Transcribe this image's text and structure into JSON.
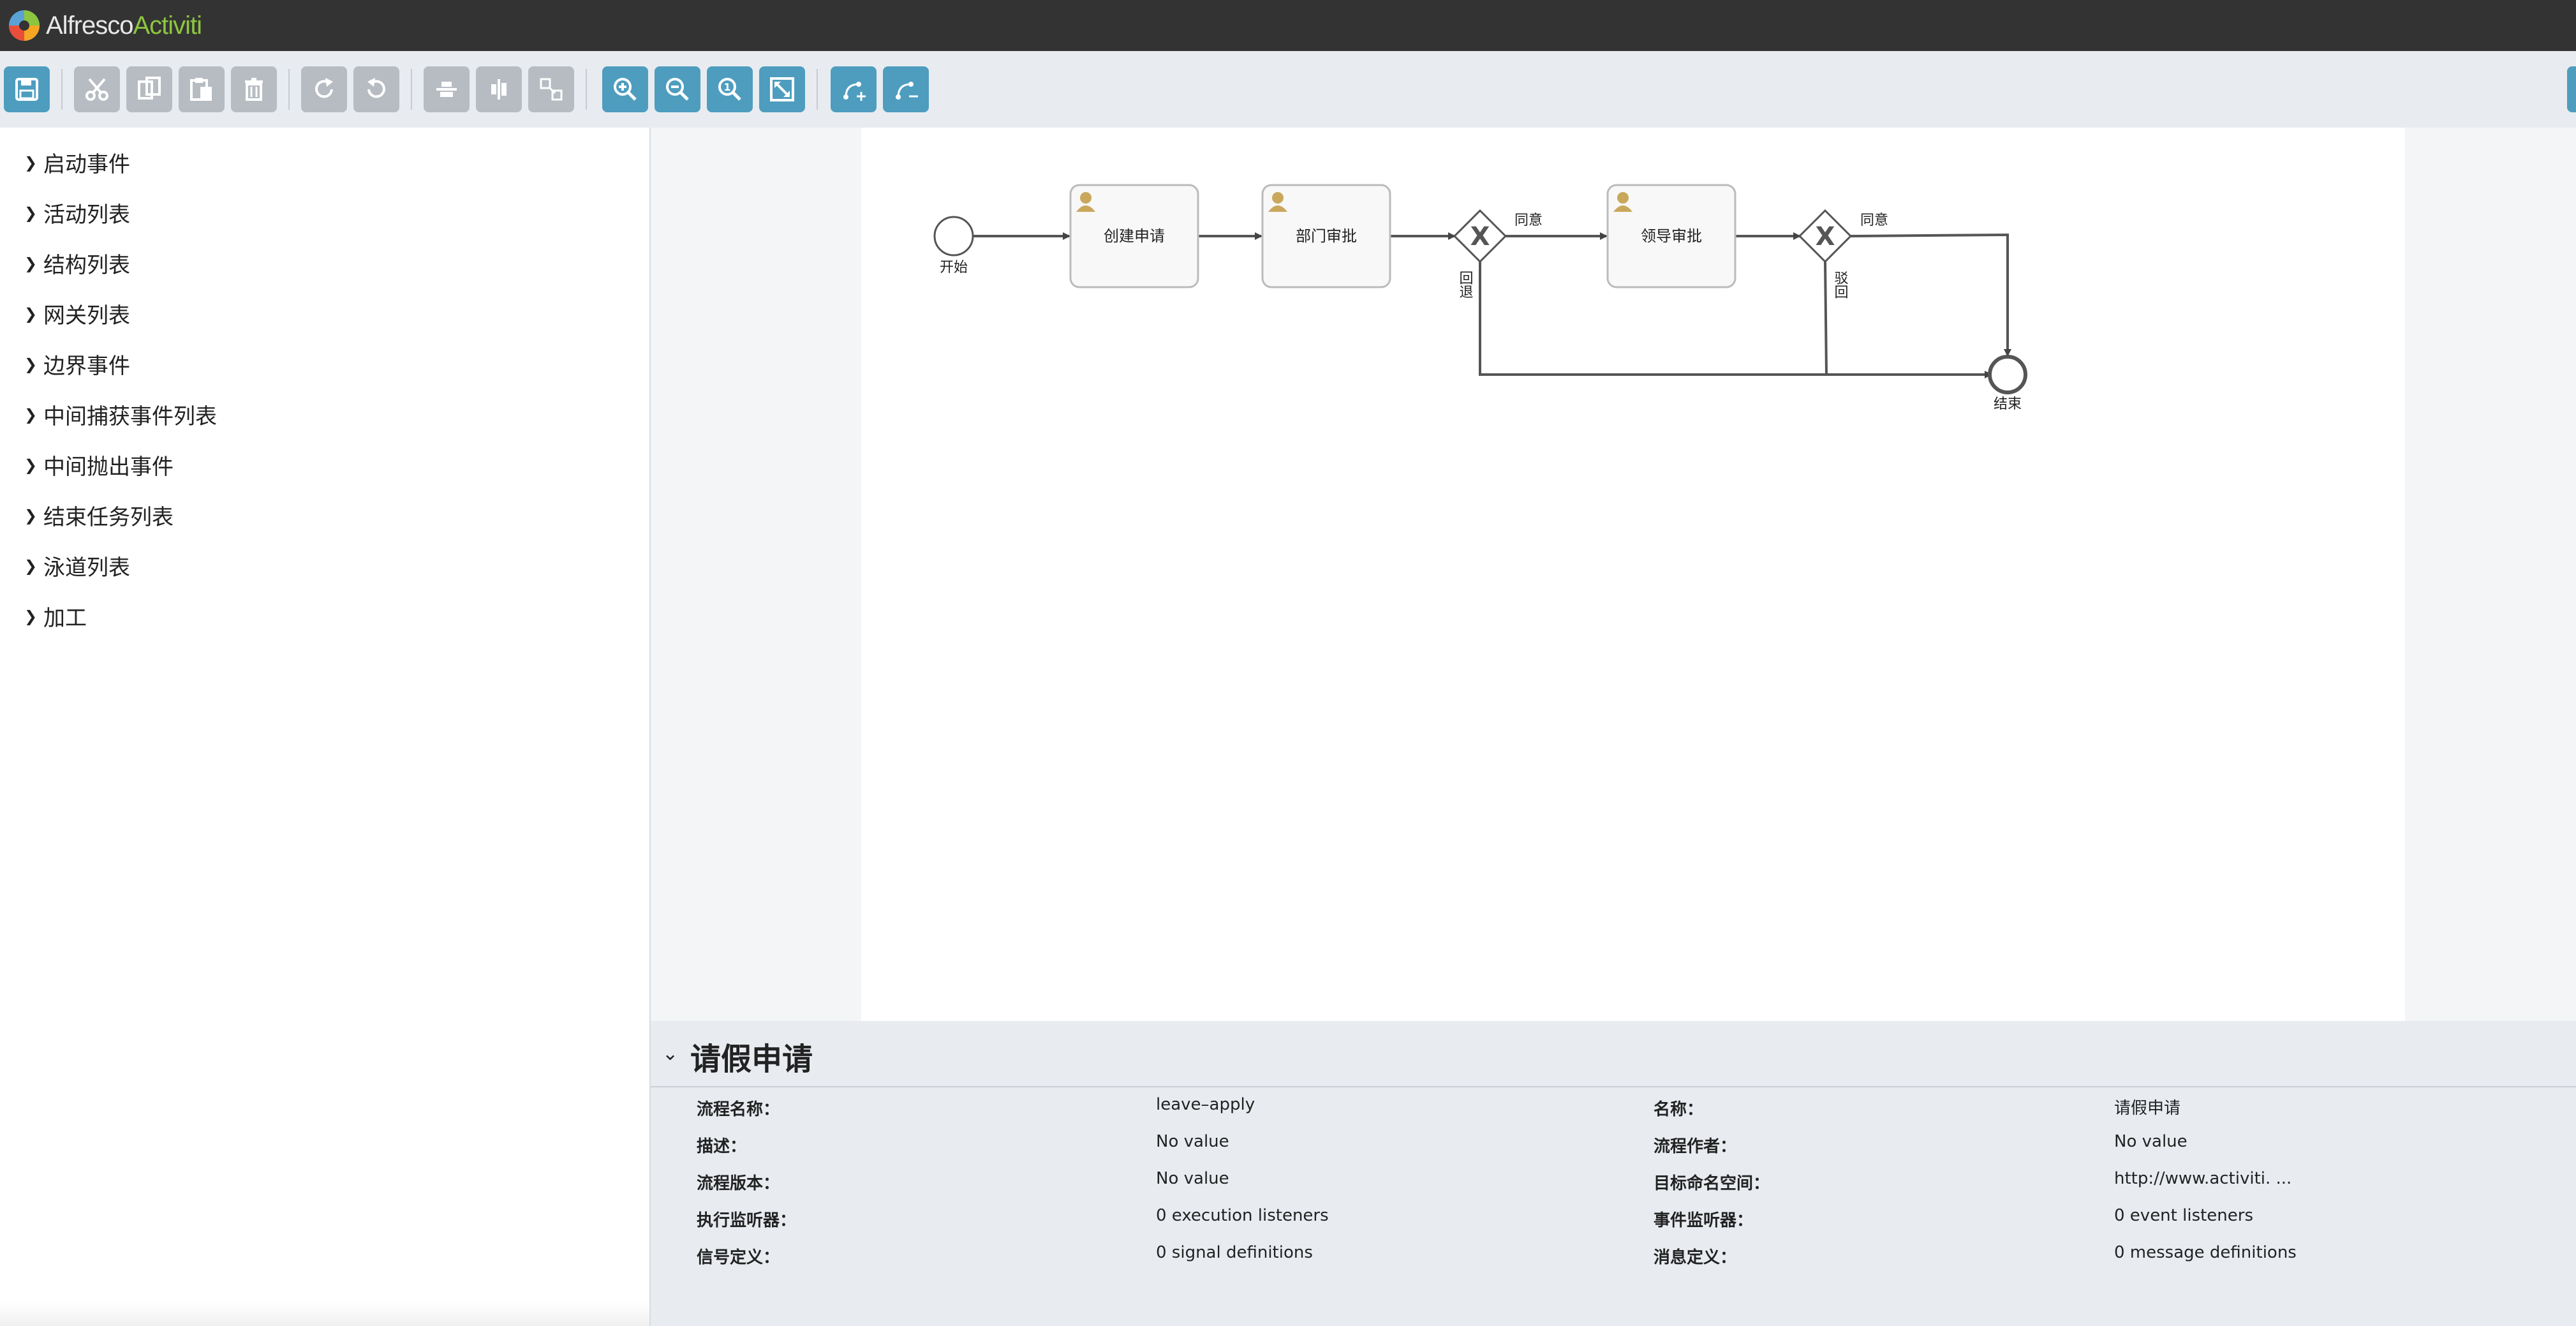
{
  "app": {
    "logo_part1": "Alfresco",
    "logo_part2": "Activiti"
  },
  "palette": {
    "items": [
      {
        "label": "启动事件"
      },
      {
        "label": "活动列表"
      },
      {
        "label": "结构列表"
      },
      {
        "label": "网关列表"
      },
      {
        "label": "边界事件"
      },
      {
        "label": "中间捕获事件列表"
      },
      {
        "label": "中间抛出事件"
      },
      {
        "label": "结束任务列表"
      },
      {
        "label": "泳道列表"
      },
      {
        "label": "加工"
      }
    ]
  },
  "toolbar": {
    "buttons": [
      {
        "name": "save-button",
        "icon": "save-icon"
      },
      {
        "name": "cut-button",
        "icon": "scissors-icon"
      },
      {
        "name": "copy-button",
        "icon": "copy-icon"
      },
      {
        "name": "paste-button",
        "icon": "paste-icon"
      },
      {
        "name": "delete-button",
        "icon": "trash-icon"
      },
      {
        "name": "redo-button",
        "icon": "redo-icon"
      },
      {
        "name": "undo-button",
        "icon": "undo-icon"
      },
      {
        "name": "align-horizontal-button",
        "icon": "align-horizontal-icon"
      },
      {
        "name": "align-vertical-button",
        "icon": "align-vertical-icon"
      },
      {
        "name": "same-size-button",
        "icon": "same-size-icon"
      },
      {
        "name": "zoom-in-button",
        "icon": "zoom-in-icon"
      },
      {
        "name": "zoom-out-button",
        "icon": "zoom-out-icon"
      },
      {
        "name": "zoom-actual-button",
        "icon": "zoom-actual-icon"
      },
      {
        "name": "zoom-fit-button",
        "icon": "fit-icon"
      },
      {
        "name": "add-bendpoint-button",
        "icon": "add-bendpoint-icon"
      },
      {
        "name": "remove-bendpoint-button",
        "icon": "remove-bendpoint-icon"
      }
    ],
    "colors": {
      "enabled": "#4e9dbf",
      "disabled": "#b6bcc2"
    }
  },
  "diagram": {
    "start_label": "开始",
    "task1": "创建申请",
    "task2": "部门审批",
    "task3": "领导审批",
    "end_label": "结束",
    "gw1_agree": "同意",
    "gw1_back": "回退",
    "gw2_agree": "同意",
    "gw2_back": "驳回"
  },
  "properties": {
    "title": "请假申请",
    "rows": [
      {
        "label": "流程名称：",
        "value": "leave–apply",
        "label2": "名称：",
        "value2": "请假申请"
      },
      {
        "label": "描述：",
        "value": "No value",
        "label2": "流程作者：",
        "value2": "No value"
      },
      {
        "label": "流程版本：",
        "value": "No value",
        "label2": "目标命名空间：",
        "value2": "http://www.activiti. ..."
      },
      {
        "label": "执行监听器：",
        "value": "0 execution listeners",
        "label2": "事件监听器：",
        "value2": "0 event listeners"
      },
      {
        "label": "信号定义：",
        "value": "0 signal definitions",
        "label2": "消息定义：",
        "value2": "0 message definitions"
      }
    ]
  }
}
